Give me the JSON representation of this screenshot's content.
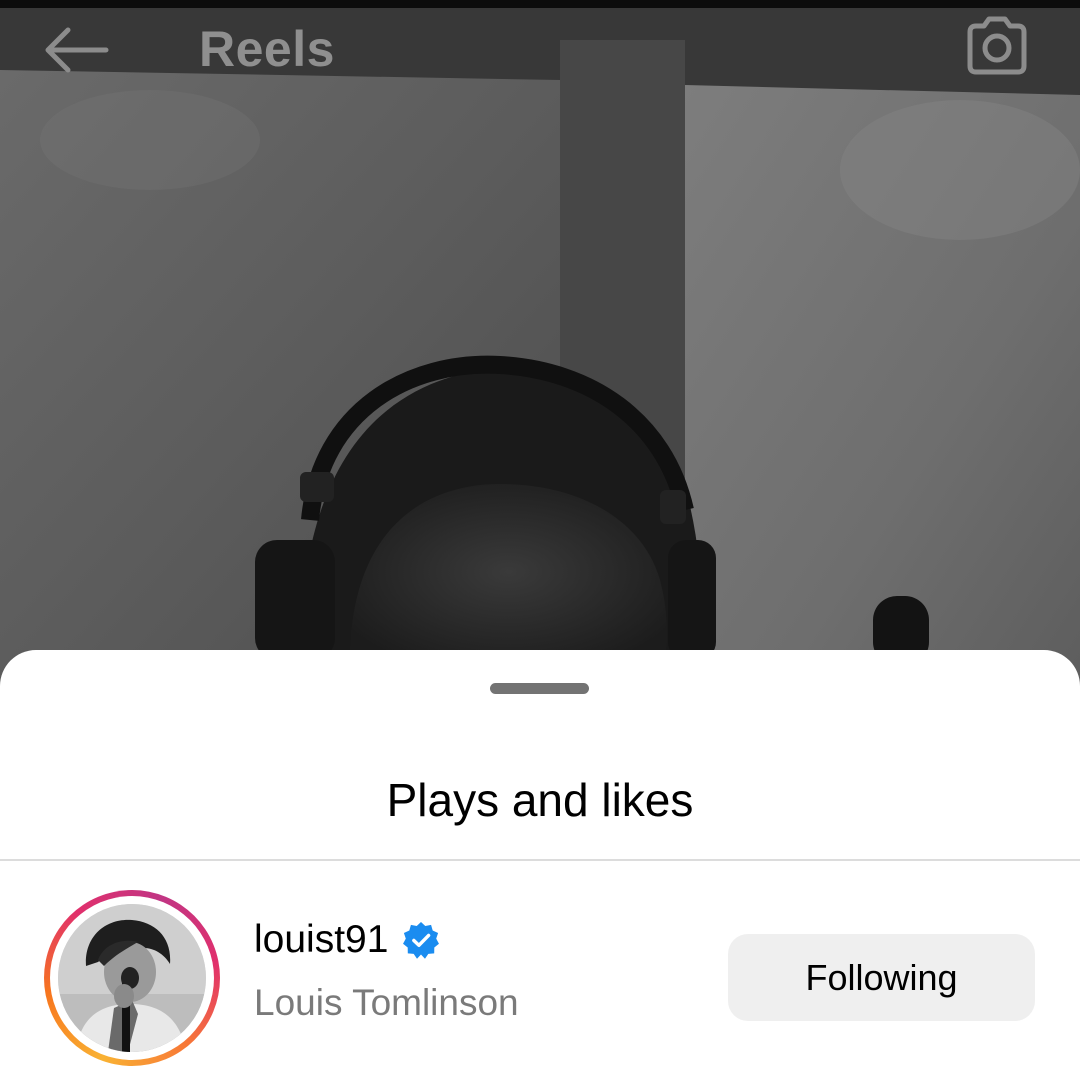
{
  "header": {
    "title": "Reels",
    "back_icon": "arrow-left-icon",
    "camera_icon": "camera-icon"
  },
  "sheet": {
    "title": "Plays and likes"
  },
  "user": {
    "username": "louist91",
    "full_name": "Louis Tomlinson",
    "verified": true,
    "follow_label": "Following"
  },
  "colors": {
    "verified_badge": "#1a8cf0",
    "follow_button_bg": "#efefef",
    "secondary_text": "#7a7a7a"
  }
}
